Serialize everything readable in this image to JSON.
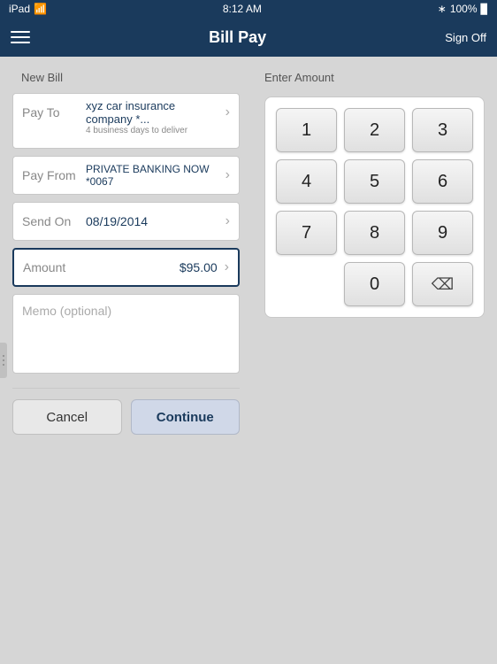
{
  "status_bar": {
    "carrier": "iPad",
    "time": "8:12 AM",
    "wifi_icon": "wifi",
    "bluetooth_icon": "bluetooth",
    "battery_level": "100%"
  },
  "header": {
    "menu_icon": "hamburger",
    "title": "Bill Pay",
    "sign_off_label": "Sign Off"
  },
  "left_panel": {
    "section_label": "New Bill",
    "pay_to": {
      "label": "Pay To",
      "value": "xyz car insurance company *... ",
      "sub_text": "4 business days to deliver"
    },
    "pay_from": {
      "label": "Pay From",
      "value": "PRIVATE BANKING NOW *0067"
    },
    "send_on": {
      "label": "Send On",
      "value": "08/19/2014"
    },
    "amount": {
      "label": "Amount",
      "value": "$95.00"
    },
    "memo": {
      "placeholder": "Memo (optional)"
    },
    "cancel_label": "Cancel",
    "continue_label": "Continue"
  },
  "right_panel": {
    "section_label": "Enter Amount",
    "numpad": {
      "keys": [
        "1",
        "2",
        "3",
        "4",
        "5",
        "6",
        "7",
        "8",
        "9",
        "",
        "0",
        "⌫"
      ]
    }
  }
}
